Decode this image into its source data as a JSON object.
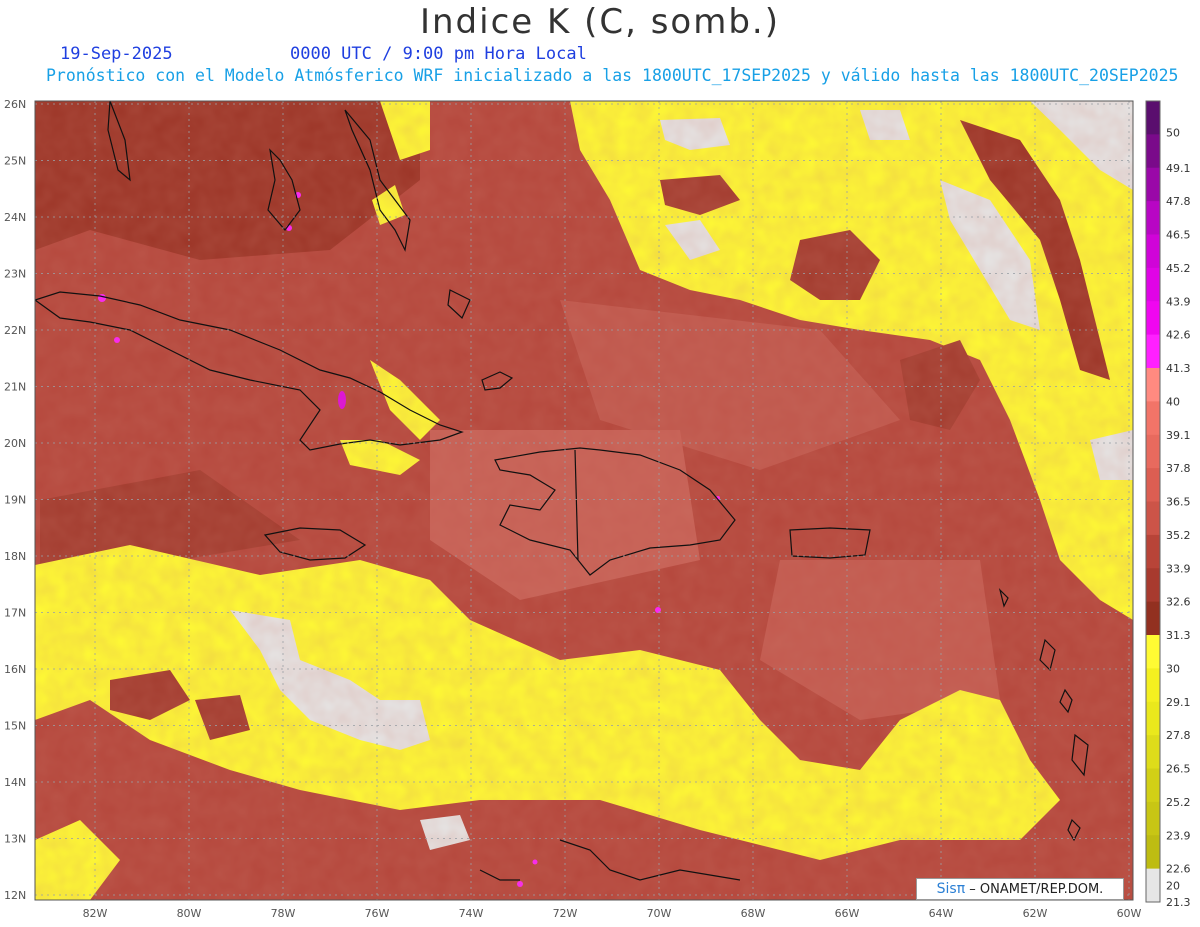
{
  "header": {
    "title": "Indice K (C, somb.)",
    "date": "19-Sep-2025",
    "time": "0000 UTC / 9:00 pm Hora Local",
    "description": "Pronóstico con el Modelo Atmósferico WRF inicializado a las 1800UTC_17SEP2025 y válido hasta las  1800UTC_20SEP2025"
  },
  "axes": {
    "lon_ticks": [
      "82W",
      "80W",
      "78W",
      "76W",
      "74W",
      "72W",
      "70W",
      "68W",
      "66W",
      "64W",
      "62W",
      "60W"
    ],
    "lat_ticks": [
      "26N",
      "25N",
      "24N",
      "23N",
      "22N",
      "21N",
      "20N",
      "19N",
      "18N",
      "17N",
      "16N",
      "15N",
      "14N",
      "13N",
      "12N"
    ]
  },
  "colorbar": {
    "labels": [
      "50",
      "49.1",
      "47.8",
      "46.5",
      "45.2",
      "43.9",
      "42.6",
      "41.3",
      "40",
      "39.1",
      "37.8",
      "36.5",
      "35.2",
      "33.9",
      "32.6",
      "31.3",
      "30",
      "29.1",
      "27.8",
      "26.5",
      "25.2",
      "23.9",
      "22.6",
      "21.3",
      "20"
    ],
    "colors": [
      "#5a0e6e",
      "#7a0a8a",
      "#9a08a8",
      "#b806c4",
      "#d004d8",
      "#e004e6",
      "#f006f0",
      "#ff20ff",
      "#ff8a80",
      "#f27468",
      "#e86a5e",
      "#dc5e52",
      "#cc5448",
      "#b84438",
      "#a83a2e",
      "#923020",
      "#fffb33",
      "#f4f020",
      "#eae81c",
      "#dedc1a",
      "#d2d016",
      "#c8c614",
      "#bebc12",
      "#e6e6e6"
    ]
  },
  "credit": {
    "brand": "Sisπ",
    "text": "– ONAMET/REP.DOM."
  }
}
